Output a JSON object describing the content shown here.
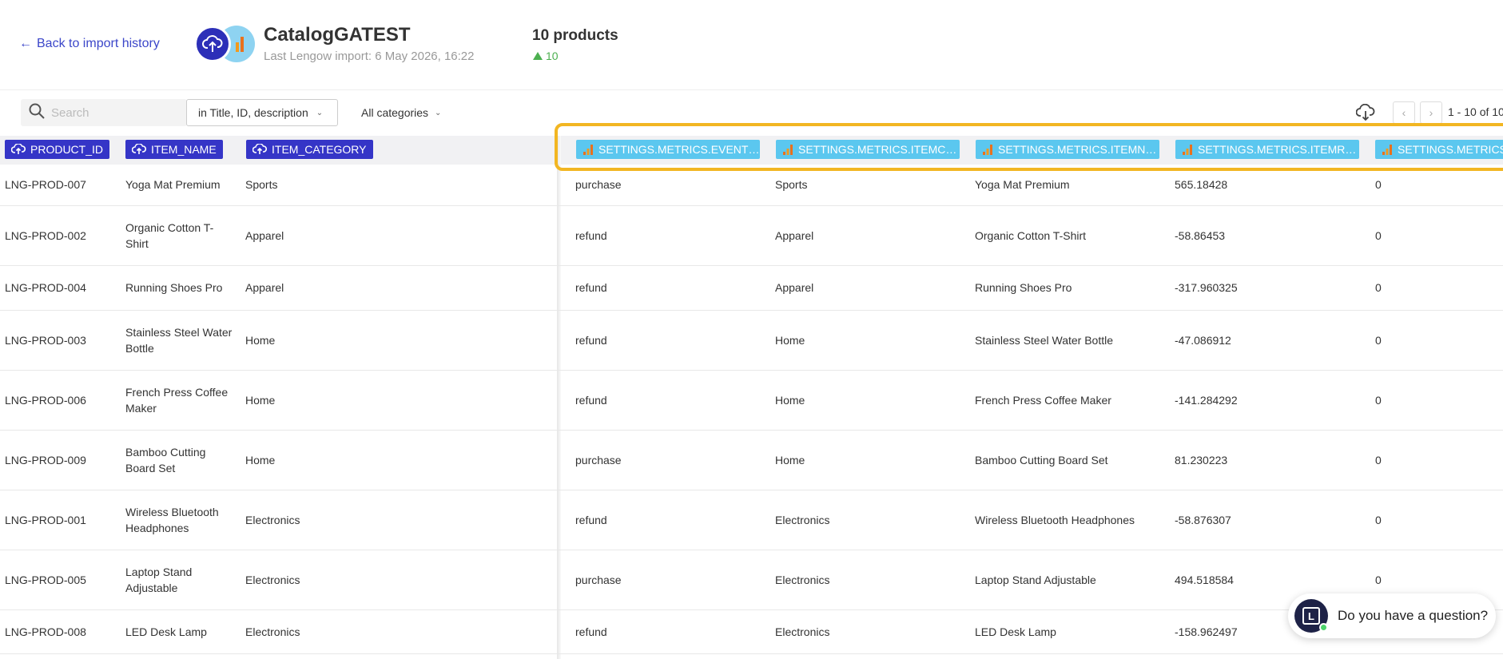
{
  "header": {
    "back_label": "Back to import history",
    "catalog_name": "CatalogGATEST",
    "last_import": "Last Lengow import: 6 May 2026, 16:22",
    "product_count": "10 products",
    "delta": "10"
  },
  "toolbar": {
    "search_placeholder": "Search",
    "scope_label": "in Title, ID, description",
    "category_label": "All categories",
    "pagination": "1 - 10 of 10"
  },
  "columns": {
    "source": [
      "PRODUCT_ID",
      "ITEM_NAME",
      "ITEM_CATEGORY"
    ],
    "mapped": [
      "SETTINGS.METRICS.EVENT…",
      "SETTINGS.METRICS.ITEMC…",
      "SETTINGS.METRICS.ITEMN…",
      "SETTINGS.METRICS.ITEMR…",
      "SETTINGS.METRICS."
    ]
  },
  "rows": [
    {
      "id": "LNG-PROD-007",
      "name": [
        "Yoga Mat Premium"
      ],
      "category": "Sports",
      "event": "purchase",
      "itemc": "Sports",
      "itemn": "Yoga Mat Premium",
      "itemr": "565.18428",
      "last": "0"
    },
    {
      "id": "LNG-PROD-002",
      "name": [
        "Organic Cotton T-",
        "Shirt"
      ],
      "category": "Apparel",
      "event": "refund",
      "itemc": "Apparel",
      "itemn": "Organic Cotton T-Shirt",
      "itemr": "-58.86453",
      "last": "0"
    },
    {
      "id": "LNG-PROD-004",
      "name": [
        "Running Shoes Pro"
      ],
      "category": "Apparel",
      "event": "refund",
      "itemc": "Apparel",
      "itemn": "Running Shoes Pro",
      "itemr": "-317.960325",
      "last": "0"
    },
    {
      "id": "LNG-PROD-003",
      "name": [
        "Stainless Steel Water",
        "Bottle"
      ],
      "category": "Home",
      "event": "refund",
      "itemc": "Home",
      "itemn": "Stainless Steel Water Bottle",
      "itemr": "-47.086912",
      "last": "0"
    },
    {
      "id": "LNG-PROD-006",
      "name": [
        "French Press Coffee",
        "Maker"
      ],
      "category": "Home",
      "event": "refund",
      "itemc": "Home",
      "itemn": "French Press Coffee Maker",
      "itemr": "-141.284292",
      "last": "0"
    },
    {
      "id": "LNG-PROD-009",
      "name": [
        "Bamboo Cutting",
        "Board Set"
      ],
      "category": "Home",
      "event": "purchase",
      "itemc": "Home",
      "itemn": "Bamboo Cutting Board Set",
      "itemr": "81.230223",
      "last": "0"
    },
    {
      "id": "LNG-PROD-001",
      "name": [
        "Wireless Bluetooth",
        "Headphones"
      ],
      "category": "Electronics",
      "event": "refund",
      "itemc": "Electronics",
      "itemn": "Wireless Bluetooth Headphones",
      "itemr": "-58.876307",
      "last": "0"
    },
    {
      "id": "LNG-PROD-005",
      "name": [
        "Laptop Stand",
        "Adjustable"
      ],
      "category": "Electronics",
      "event": "purchase",
      "itemc": "Electronics",
      "itemn": "Laptop Stand Adjustable",
      "itemr": "494.518584",
      "last": "0"
    },
    {
      "id": "LNG-PROD-008",
      "name": [
        "LED Desk Lamp"
      ],
      "category": "Electronics",
      "event": "refund",
      "itemc": "Electronics",
      "itemn": "LED Desk Lamp",
      "itemr": "-158.962497",
      "last": ""
    }
  ],
  "chat": {
    "prompt": "Do you have a question?",
    "avatar_letter": "L"
  },
  "colors": {
    "brand_blue": "#3535c7",
    "ga_blue": "#5bc7ef",
    "highlight": "#f2b622",
    "positive": "#4cb050"
  }
}
